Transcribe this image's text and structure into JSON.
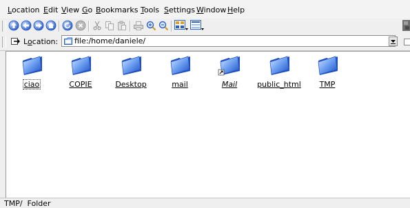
{
  "menubar": {
    "items": [
      {
        "label": "Location",
        "u": "L",
        "rest": "ocation"
      },
      {
        "label": "Edit",
        "u": "E",
        "rest": "dit"
      },
      {
        "label": "View",
        "u": "V",
        "rest": "iew"
      },
      {
        "label": "Go",
        "u": "G",
        "rest": "o"
      },
      {
        "label": "Bookmarks",
        "u": "B",
        "rest": "ookmarks"
      },
      {
        "label": "Tools",
        "u": "T",
        "rest": "ools"
      },
      {
        "label": "Settings",
        "u": "S",
        "rest": "ettings"
      },
      {
        "label": "Window",
        "u": "W",
        "rest": "indow"
      },
      {
        "label": "Help",
        "u": "H",
        "rest": "elp"
      }
    ]
  },
  "toolbar": {
    "icons": [
      "up-arrow-icon",
      "back-arrow-icon",
      "forward-arrow-icon",
      "home-icon",
      "reload-icon",
      "stop-icon",
      "cut-icon",
      "copy-icon",
      "paste-icon",
      "print-icon",
      "zoom-in-icon",
      "zoom-out-icon",
      "icon-view-icon",
      "detail-view-icon"
    ]
  },
  "location": {
    "label_u": "o",
    "label_pre": "L",
    "label_rest": "cation:",
    "url": "file:/home/daniele/"
  },
  "files": [
    {
      "name": "ciao",
      "italic": false,
      "symlink": false
    },
    {
      "name": "COPIE",
      "italic": false,
      "symlink": false
    },
    {
      "name": "Desktop",
      "italic": false,
      "symlink": false
    },
    {
      "name": "mail",
      "italic": false,
      "symlink": false
    },
    {
      "name": "Mail",
      "italic": true,
      "symlink": true
    },
    {
      "name": "public_html",
      "italic": false,
      "symlink": false
    },
    {
      "name": "TMP",
      "italic": false,
      "symlink": false
    }
  ],
  "status": {
    "text": "TMP/  Folder"
  },
  "colors": {
    "folder_blue": "#3e78e0",
    "folder_light": "#b7d2ff",
    "arrow_blue": "#2a5fc8",
    "chrome": "#efefef"
  }
}
